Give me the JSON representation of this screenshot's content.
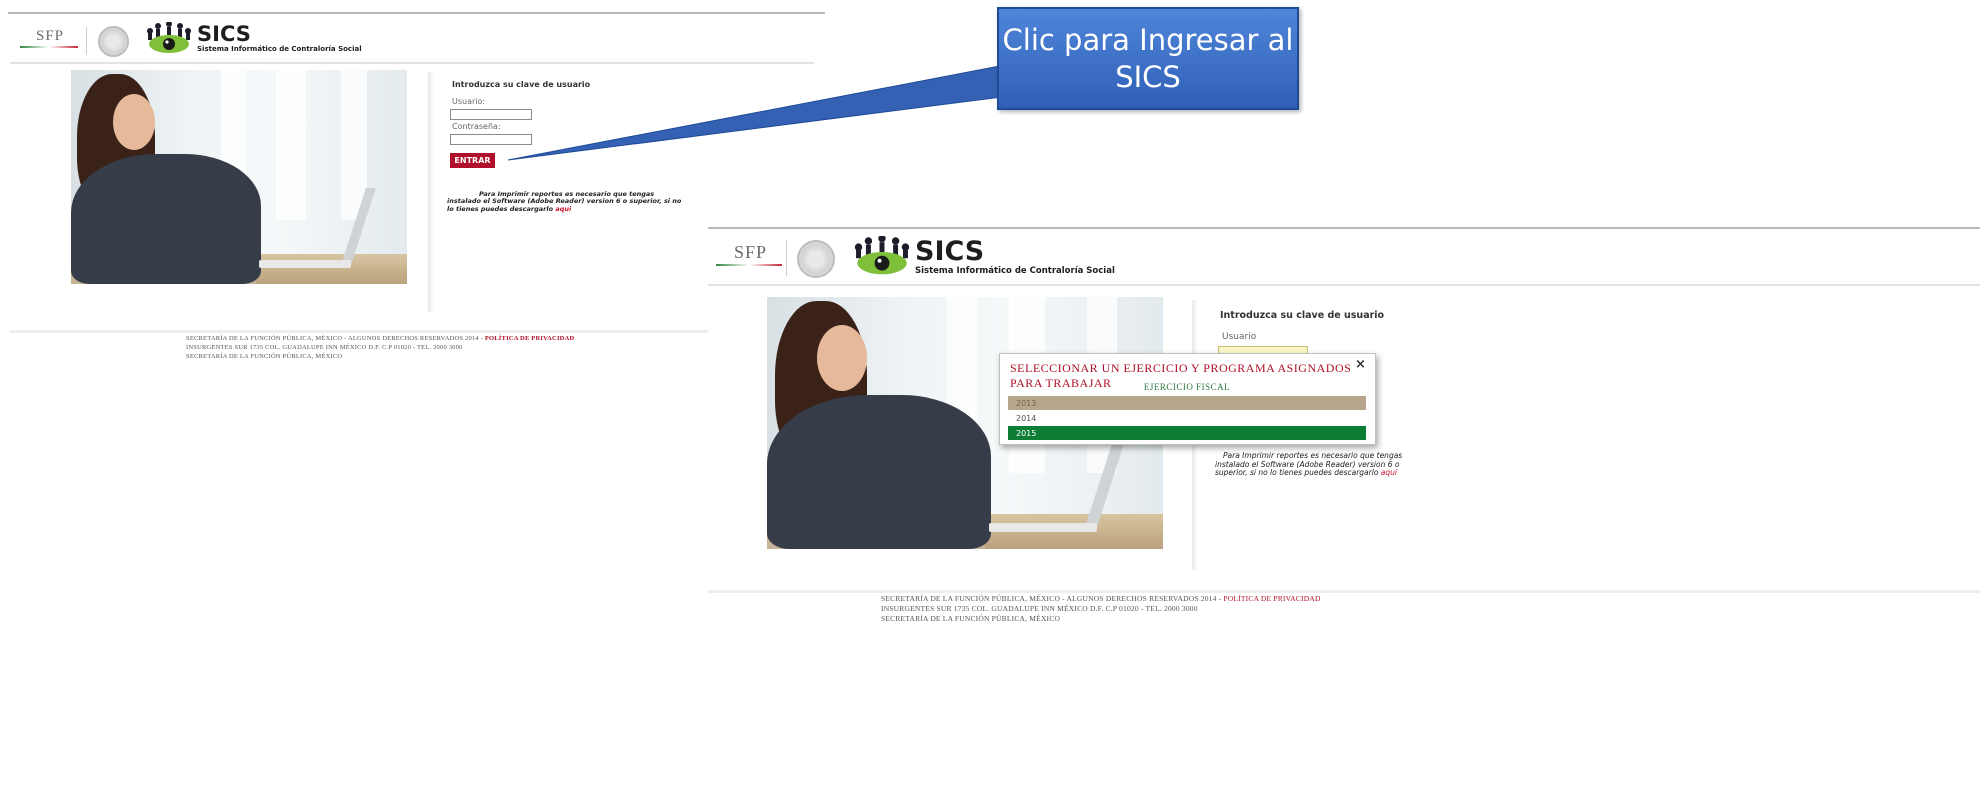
{
  "screen1": {
    "header": {
      "sfp_logo": "SFP",
      "sics_title": "SICS",
      "sics_subtitle": "Sistema Informático de Contraloría Social"
    },
    "login": {
      "title": "Introduzca su clave de usuario",
      "usuario_label": "Usuario:",
      "usuario_value": "",
      "password_label": "Contraseña:",
      "password_value": "",
      "entrar_label": "ENTRAR"
    },
    "note": {
      "text": "Para Imprimir reportes es necesario que tengas instalado el Software (Adobe Reader) version 6 o superior, si no lo tienes puedes descargarlo ",
      "link": "aqui"
    },
    "footer": {
      "line1": "SECRETARÍA DE LA FUNCIÓN PÚBLICA, MÉXICO - ALGUNOS DERECHOS RESERVADOS 2014 - ",
      "privacy": "POLÍTICA DE PRIVACIDAD",
      "line2": "INSURGENTES SUR 1735 COL. GUADALUPE INN MÉXICO D.F. C.P 01020 - TEL. 2000 3000",
      "line3": "SECRETARÍA DE LA FUNCIÓN PÚBLICA, MÉXICO"
    }
  },
  "callout": {
    "text": "Clic para Ingresar al SICS"
  },
  "screen2": {
    "header": {
      "sfp_logo": "SFP",
      "sics_title": "SICS",
      "sics_subtitle": "Sistema Informático de Contraloría Social"
    },
    "login": {
      "title": "Introduzca su clave de usuario",
      "usuario_label": "Usuario"
    },
    "modal": {
      "title": "SELECCIONAR UN EJERCICIO Y PROGRAMA ASIGNADOS PARA TRABAJAR",
      "close": "×",
      "column_header": "EJERCICIO FISCAL",
      "years": [
        "2013",
        "2014",
        "2015"
      ],
      "row_colors": [
        "#b8a68c",
        "#ffffff",
        "#0d7d36"
      ]
    },
    "note": {
      "text": "Para Imprimir reportes es necesario que tengas instalado el Software (Adobe Reader) version 6 o superior, si no lo tienes puedes descargarlo ",
      "link": "aqui"
    },
    "footer": {
      "line1": "SECRETARÍA DE LA FUNCIÓN PÚBLICA, MÉXICO - ALGUNOS DERECHOS RESERVADOS 2014 - ",
      "privacy": "POLÍTICA DE PRIVACIDAD",
      "line2": "INSURGENTES SUR 1735 COL. GUADALUPE INN MÉXICO D.F. C.P 01020 - TEL. 2000 3000",
      "line3": "SECRETARÍA DE LA FUNCIÓN PÚBLICA, MÉXICO"
    }
  }
}
